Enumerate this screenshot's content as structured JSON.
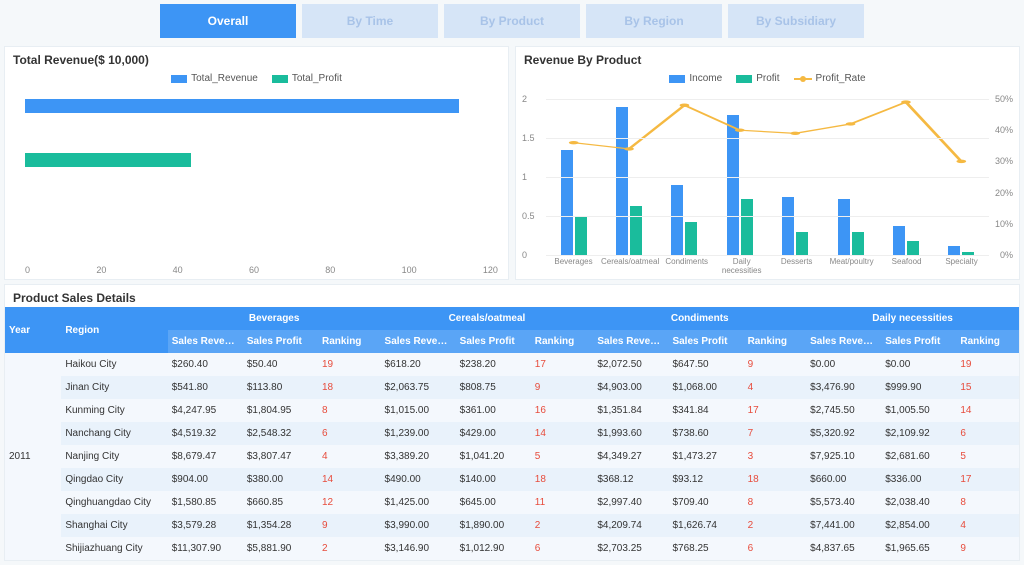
{
  "tabs": {
    "overall": "Overall",
    "by_time": "By Time",
    "by_product": "By Product",
    "by_region": "By Region",
    "by_subsidiary": "By Subsidiary"
  },
  "left_chart": {
    "title": "Total Revenue($ 10,000)",
    "legend_revenue": "Total_Revenue",
    "legend_profit": "Total_Profit"
  },
  "right_chart": {
    "title": "Revenue By Product",
    "legend_income": "Income",
    "legend_profit": "Profit",
    "legend_rate": "Profit_Rate"
  },
  "table": {
    "title": "Product Sales Details",
    "head": {
      "year": "Year",
      "region": "Region",
      "beverages": "Beverages",
      "cereals": "Cereals/oatmeal",
      "condiments": "Condiments",
      "daily": "Daily necessities",
      "sales_revenue": "Sales Revenue",
      "sales_profit": "Sales Profit",
      "ranking": "Ranking"
    },
    "year": "2011",
    "rows": [
      {
        "region": "Haikou City",
        "bev_r": "$260.40",
        "bev_p": "$50.40",
        "bev_k": "19",
        "cer_r": "$618.20",
        "cer_p": "$238.20",
        "cer_k": "17",
        "con_r": "$2,072.50",
        "con_p": "$647.50",
        "con_k": "9",
        "dai_r": "$0.00",
        "dai_p": "$0.00",
        "dai_k": "19"
      },
      {
        "region": "Jinan City",
        "bev_r": "$541.80",
        "bev_p": "$113.80",
        "bev_k": "18",
        "cer_r": "$2,063.75",
        "cer_p": "$808.75",
        "cer_k": "9",
        "con_r": "$4,903.00",
        "con_p": "$1,068.00",
        "con_k": "4",
        "dai_r": "$3,476.90",
        "dai_p": "$999.90",
        "dai_k": "15"
      },
      {
        "region": "Kunming City",
        "bev_r": "$4,247.95",
        "bev_p": "$1,804.95",
        "bev_k": "8",
        "cer_r": "$1,015.00",
        "cer_p": "$361.00",
        "cer_k": "16",
        "con_r": "$1,351.84",
        "con_p": "$341.84",
        "con_k": "17",
        "dai_r": "$2,745.50",
        "dai_p": "$1,005.50",
        "dai_k": "14"
      },
      {
        "region": "Nanchang City",
        "bev_r": "$4,519.32",
        "bev_p": "$2,548.32",
        "bev_k": "6",
        "cer_r": "$1,239.00",
        "cer_p": "$429.00",
        "cer_k": "14",
        "con_r": "$1,993.60",
        "con_p": "$738.60",
        "con_k": "7",
        "dai_r": "$5,320.92",
        "dai_p": "$2,109.92",
        "dai_k": "6"
      },
      {
        "region": "Nanjing City",
        "bev_r": "$8,679.47",
        "bev_p": "$3,807.47",
        "bev_k": "4",
        "cer_r": "$3,389.20",
        "cer_p": "$1,041.20",
        "cer_k": "5",
        "con_r": "$4,349.27",
        "con_p": "$1,473.27",
        "con_k": "3",
        "dai_r": "$7,925.10",
        "dai_p": "$2,681.60",
        "dai_k": "5"
      },
      {
        "region": "Qingdao City",
        "bev_r": "$904.00",
        "bev_p": "$380.00",
        "bev_k": "14",
        "cer_r": "$490.00",
        "cer_p": "$140.00",
        "cer_k": "18",
        "con_r": "$368.12",
        "con_p": "$93.12",
        "con_k": "18",
        "dai_r": "$660.00",
        "dai_p": "$336.00",
        "dai_k": "17"
      },
      {
        "region": "Qinghuangdao City",
        "bev_r": "$1,580.85",
        "bev_p": "$660.85",
        "bev_k": "12",
        "cer_r": "$1,425.00",
        "cer_p": "$645.00",
        "cer_k": "11",
        "con_r": "$2,997.40",
        "con_p": "$709.40",
        "con_k": "8",
        "dai_r": "$5,573.40",
        "dai_p": "$2,038.40",
        "dai_k": "8"
      },
      {
        "region": "Shanghai City",
        "bev_r": "$3,579.28",
        "bev_p": "$1,354.28",
        "bev_k": "9",
        "cer_r": "$3,990.00",
        "cer_p": "$1,890.00",
        "cer_k": "2",
        "con_r": "$4,209.74",
        "con_p": "$1,626.74",
        "con_k": "2",
        "dai_r": "$7,441.00",
        "dai_p": "$2,854.00",
        "dai_k": "4"
      },
      {
        "region": "Shijiazhuang City",
        "bev_r": "$11,307.90",
        "bev_p": "$5,881.90",
        "bev_k": "2",
        "cer_r": "$3,146.90",
        "cer_p": "$1,012.90",
        "cer_k": "6",
        "con_r": "$2,703.25",
        "con_p": "$768.25",
        "con_k": "6",
        "dai_r": "$4,837.65",
        "dai_p": "$1,965.65",
        "dai_k": "9"
      }
    ]
  },
  "chart_data": [
    {
      "type": "bar",
      "orientation": "horizontal",
      "title": "Total Revenue($ 10,000)",
      "xlabel": "",
      "ylabel": "",
      "xlim": [
        0,
        120
      ],
      "xticks": [
        0,
        20,
        40,
        60,
        80,
        100,
        120
      ],
      "series": [
        {
          "name": "Total_Revenue",
          "values": [
            110
          ],
          "color": "#3d95f5"
        },
        {
          "name": "Total_Profit",
          "values": [
            42
          ],
          "color": "#1abc9c"
        }
      ]
    },
    {
      "type": "bar+line",
      "title": "Revenue By Product",
      "categories": [
        "Beverages",
        "Cereals/oatmeal",
        "Condiments",
        "Daily necessities",
        "Desserts",
        "Meat/poultry",
        "Seafood",
        "Specialty"
      ],
      "ylim": [
        0,
        2
      ],
      "yticks": [
        0,
        0.5,
        1,
        1.5,
        2
      ],
      "y2lim": [
        0,
        50
      ],
      "y2ticks": [
        0,
        10,
        20,
        30,
        40,
        50
      ],
      "series": [
        {
          "name": "Income",
          "type": "bar",
          "axis": "y",
          "color": "#3d95f5",
          "values": [
            1.35,
            1.9,
            0.9,
            1.8,
            0.75,
            0.72,
            0.37,
            0.12
          ]
        },
        {
          "name": "Profit",
          "type": "bar",
          "axis": "y",
          "color": "#1abc9c",
          "values": [
            0.5,
            0.63,
            0.42,
            0.72,
            0.3,
            0.3,
            0.18,
            0.04
          ]
        },
        {
          "name": "Profit_Rate",
          "type": "line",
          "axis": "y2",
          "color": "#f5b942",
          "values": [
            36,
            34,
            48,
            40,
            39,
            42,
            49,
            30
          ]
        }
      ]
    }
  ],
  "colors": {
    "blue": "#3d95f5",
    "teal": "#1abc9c",
    "orange": "#f5b942"
  }
}
